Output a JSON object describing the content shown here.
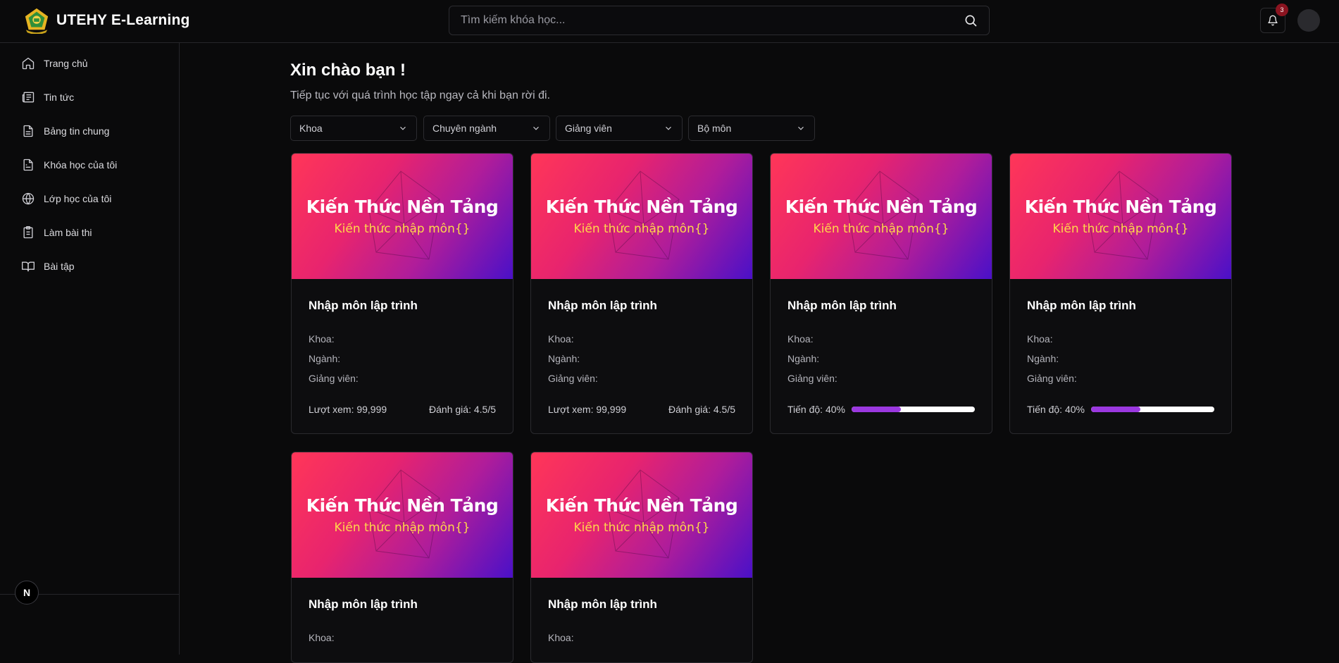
{
  "header": {
    "brand_name": "UTEHY E-Learning",
    "search_placeholder": "Tìm kiếm khóa học...",
    "notification_count": "3"
  },
  "sidebar": {
    "items": [
      {
        "label": "Trang chủ",
        "icon": "home-icon"
      },
      {
        "label": "Tin tức",
        "icon": "newspaper-icon"
      },
      {
        "label": "Bảng tin chung",
        "icon": "document-icon"
      },
      {
        "label": "Khóa học của tôi",
        "icon": "file-text-icon"
      },
      {
        "label": "Lớp học của tôi",
        "icon": "globe-icon"
      },
      {
        "label": "Làm bài thi",
        "icon": "clipboard-icon"
      },
      {
        "label": "Bài tập",
        "icon": "book-icon"
      }
    ],
    "footer_badge": "N"
  },
  "main": {
    "greeting": "Xin chào bạn !",
    "subtitle": "Tiếp tục với quá trình học tập ngay cả khi bạn rời đi.",
    "filters": [
      "Khoa",
      "Chuyên ngành",
      "Giảng viên",
      "Bộ môn"
    ]
  },
  "courses": [
    {
      "banner_title": "Kiến Thức Nền Tảng",
      "banner_sub": "Kiến thức nhập môn{}",
      "title": "Nhập môn lập trình",
      "khoa": "Khoa:",
      "nganh": "Ngành:",
      "giangvien": "Giảng viên:",
      "views": "Lượt xem: 99,999",
      "rating": "Đánh giá: 4.5/5"
    },
    {
      "banner_title": "Kiến Thức Nền Tảng",
      "banner_sub": "Kiến thức nhập môn{}",
      "title": "Nhập môn lập trình",
      "khoa": "Khoa:",
      "nganh": "Ngành:",
      "giangvien": "Giảng viên:",
      "views": "Lượt xem: 99,999",
      "rating": "Đánh giá: 4.5/5"
    },
    {
      "banner_title": "Kiến Thức Nền Tảng",
      "banner_sub": "Kiến thức nhập môn{}",
      "title": "Nhập môn lập trình",
      "khoa": "Khoa:",
      "nganh": "Ngành:",
      "giangvien": "Giảng viên:",
      "progress_label": "Tiến độ: 40%",
      "progress": 0.4
    },
    {
      "banner_title": "Kiến Thức Nền Tảng",
      "banner_sub": "Kiến thức nhập môn{}",
      "title": "Nhập môn lập trình",
      "khoa": "Khoa:",
      "nganh": "Ngành:",
      "giangvien": "Giảng viên:",
      "progress_label": "Tiến độ: 40%",
      "progress": 0.4
    },
    {
      "banner_title": "Kiến Thức Nền Tảng",
      "banner_sub": "Kiến thức nhập môn{}",
      "title": "Nhập môn lập trình",
      "khoa": "Khoa:"
    },
    {
      "banner_title": "Kiến Thức Nền Tảng",
      "banner_sub": "Kiến thức nhập môn{}",
      "title": "Nhập môn lập trình",
      "khoa": "Khoa:"
    }
  ],
  "colors": {
    "background": "#0a0a0b",
    "accent_progress": "#9b38e0",
    "badge": "#8b1420",
    "banner_rating_yellow": "#ffd84a"
  }
}
